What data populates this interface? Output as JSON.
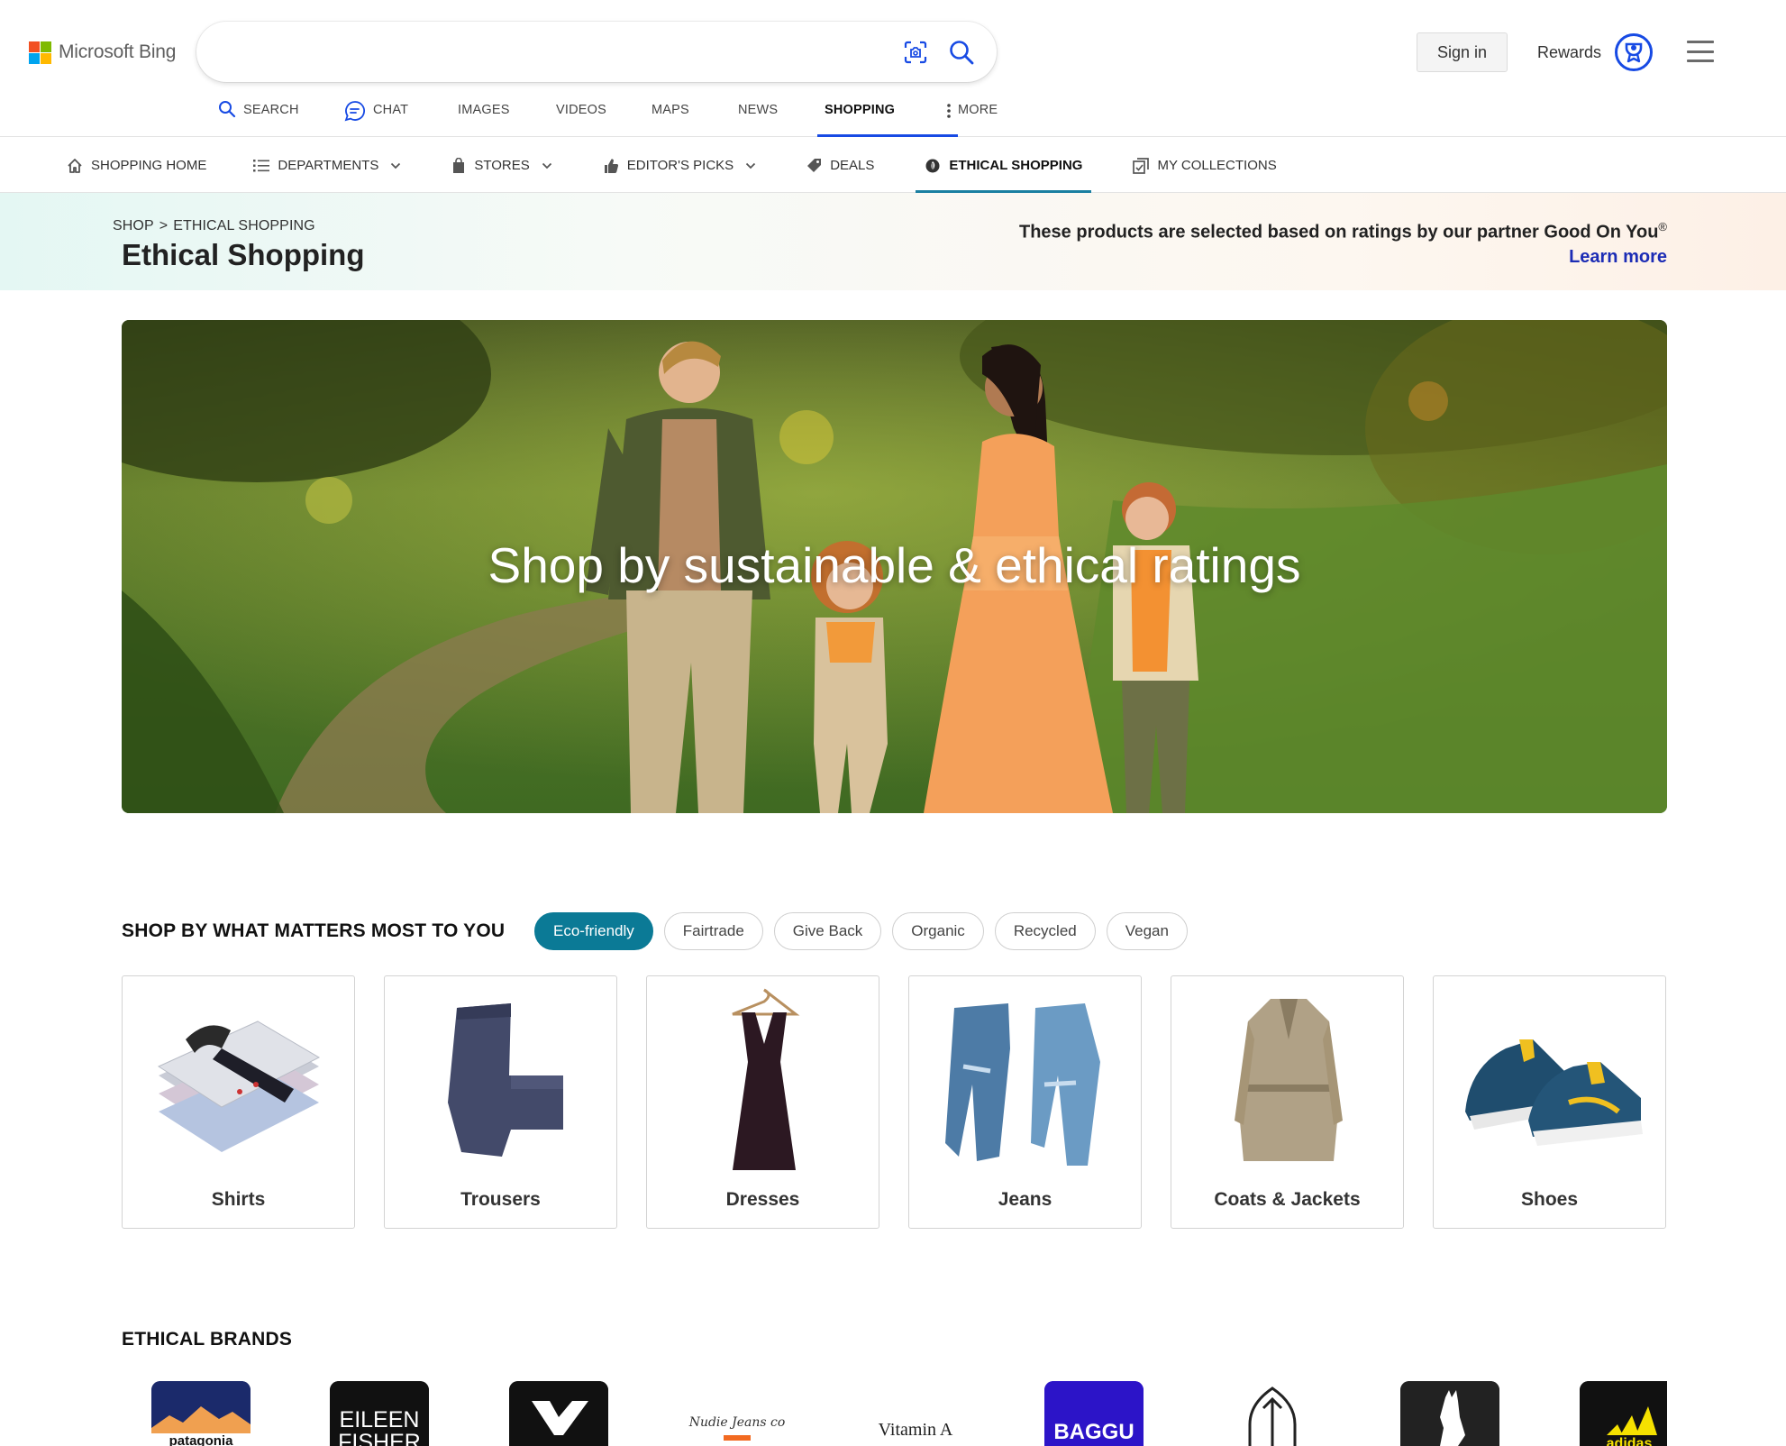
{
  "header": {
    "logo_text": "Microsoft Bing",
    "search": {
      "value": "",
      "placeholder": ""
    },
    "sign_in_label": "Sign in",
    "rewards_label": "Rewards"
  },
  "scopes": [
    {
      "label": "SEARCH",
      "icon": "search-icon"
    },
    {
      "label": "CHAT",
      "icon": "chat-icon"
    },
    {
      "label": "IMAGES"
    },
    {
      "label": "VIDEOS"
    },
    {
      "label": "MAPS"
    },
    {
      "label": "NEWS"
    },
    {
      "label": "SHOPPING",
      "active": true
    },
    {
      "label": "MORE",
      "icon": "more-dots-icon"
    }
  ],
  "shop_nav": [
    {
      "label": "SHOPPING HOME",
      "icon": "home-icon"
    },
    {
      "label": "DEPARTMENTS",
      "icon": "list-icon",
      "dropdown": true
    },
    {
      "label": "STORES",
      "icon": "shopping-bag-icon",
      "dropdown": true
    },
    {
      "label": "EDITOR'S PICKS",
      "icon": "thumbs-up-icon",
      "dropdown": true
    },
    {
      "label": "DEALS",
      "icon": "tag-icon"
    },
    {
      "label": "ETHICAL SHOPPING",
      "icon": "ethical-leaf-icon",
      "active": true
    },
    {
      "label": "MY COLLECTIONS",
      "icon": "collections-icon"
    }
  ],
  "page": {
    "breadcrumb": {
      "root": "SHOP",
      "separator": ">",
      "current": "ETHICAL SHOPPING"
    },
    "title": "Ethical Shopping",
    "partner_note": "These products are selected based on ratings by our partner Good On You",
    "partner_note_mark": "®",
    "learn_more": "Learn more"
  },
  "hero": {
    "title": "Shop by sustainable & ethical ratings",
    "image": "family-walking-in-meadow"
  },
  "filters": {
    "heading": "SHOP BY WHAT MATTERS MOST TO YOU",
    "chips": [
      {
        "label": "Eco-friendly",
        "active": true
      },
      {
        "label": "Fairtrade"
      },
      {
        "label": "Give Back"
      },
      {
        "label": "Organic"
      },
      {
        "label": "Recycled"
      },
      {
        "label": "Vegan"
      }
    ]
  },
  "categories": [
    {
      "label": "Shirts",
      "image": "folded-shirts"
    },
    {
      "label": "Trousers",
      "image": "folded-trousers"
    },
    {
      "label": "Dresses",
      "image": "dress-on-hanger"
    },
    {
      "label": "Jeans",
      "image": "jeans"
    },
    {
      "label": "Coats & Jackets",
      "image": "trench-coat"
    },
    {
      "label": "Shoes",
      "image": "sneakers"
    }
  ],
  "brands": {
    "heading": "ETHICAL BRANDS",
    "items": [
      {
        "name": "patagonia",
        "text": "patagonia"
      },
      {
        "name": "eileen-fisher",
        "text_line1": "EILEEN",
        "text_line2": "FISHER"
      },
      {
        "name": "veja",
        "text": "V"
      },
      {
        "name": "nudie-jeans",
        "text": "Nudie Jeans co"
      },
      {
        "name": "vitamin-a",
        "text": "Vitamin A"
      },
      {
        "name": "baggu",
        "text": "BAGGU"
      },
      {
        "name": "outline-brand"
      },
      {
        "name": "llama-brand"
      },
      {
        "name": "adidas",
        "text": "adidas"
      }
    ]
  },
  "colors": {
    "accent_blue": "#174ae4",
    "teal_active": "#1a7fa1",
    "chip_active": "#0b7a96",
    "learn_more": "#1c2cb5"
  }
}
